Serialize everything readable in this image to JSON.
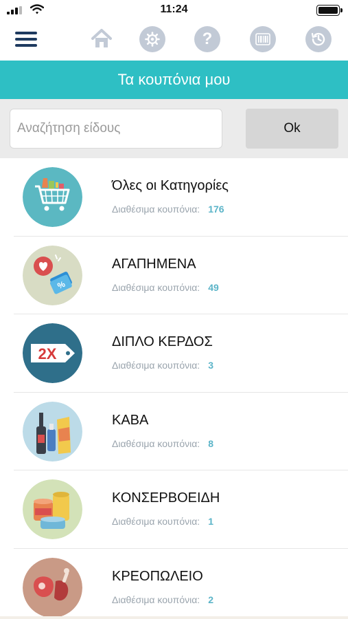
{
  "status_bar": {
    "time": "11:24"
  },
  "toolbar": {
    "icons": [
      "menu-icon",
      "home-icon",
      "settings-icon",
      "help-icon",
      "barcode-icon",
      "history-icon"
    ],
    "help_glyph": "?"
  },
  "header": {
    "title": "Τα κουπόνια μου"
  },
  "search": {
    "placeholder": "Αναζήτηση είδους",
    "value": "",
    "ok_label": "Ok"
  },
  "categories": [
    {
      "title": "Όλες οι Κατηγορίες",
      "label": "Διαθέσιμα κουπόνια:",
      "count": "176",
      "icon": "shopping-cart-icon"
    },
    {
      "title": "ΑΓΑΠΗΜΕΝΑ",
      "label": "Διαθέσιμα κουπόνια:",
      "count": "49",
      "icon": "heart-tag-icon"
    },
    {
      "title": "ΔΙΠΛΟ ΚΕΡΔΟΣ",
      "label": "Διαθέσιμα κουπόνια:",
      "count": "3",
      "icon": "double-tag-icon",
      "badge": "2X"
    },
    {
      "title": "ΚΑΒΑ",
      "label": "Διαθέσιμα κουπόνια:",
      "count": "8",
      "icon": "bottles-icon"
    },
    {
      "title": "ΚΟΝΣΕΡΒΟΕΙΔΗ",
      "label": "Διαθέσιμα κουπόνια:",
      "count": "1",
      "icon": "cans-icon"
    },
    {
      "title": "ΚΡΕΟΠΩΛΕΙΟ",
      "label": "Διαθέσιμα κουπόνια:",
      "count": "2",
      "icon": "meat-icon"
    }
  ],
  "colors": {
    "accent": "#2ebfc4",
    "count": "#5bb4c8",
    "toolbar_icon": "#c2cad6",
    "menu": "#1e3a5f"
  }
}
